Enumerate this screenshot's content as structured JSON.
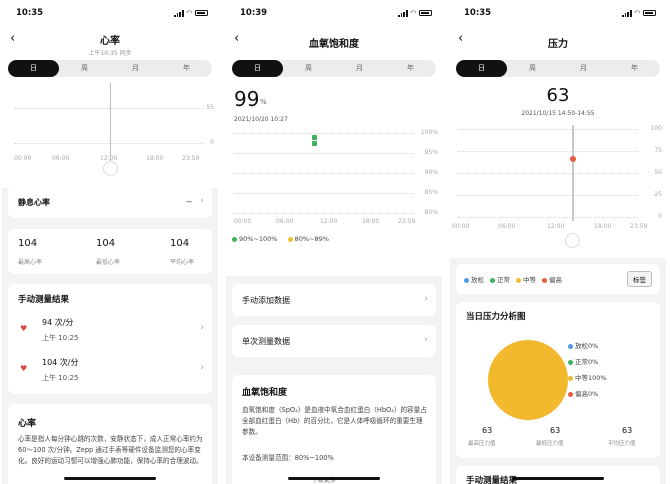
{
  "status_time_1": "10:35",
  "status_time_2": "10:39",
  "status_time_3": "10:35",
  "tabs": [
    "日",
    "周",
    "月",
    "年"
  ],
  "heart": {
    "title": "心率",
    "sync": "上午10:35 同步",
    "y_ticks": [
      "55",
      "0"
    ],
    "x_ticks": [
      "00:00",
      "06:00",
      "12:00",
      "18:00",
      "23:59"
    ],
    "resting_label": "静息心率",
    "resting_value": "--",
    "stats": [
      {
        "value": "104",
        "label": "最高心率"
      },
      {
        "value": "104",
        "label": "最低心率"
      },
      {
        "value": "104",
        "label": "平均心率"
      }
    ],
    "manual_title": "手动测量结果",
    "manual_items": [
      {
        "value": "94 次/分",
        "time": "上午 10:25"
      },
      {
        "value": "104 次/分",
        "time": "上午 10:25"
      }
    ],
    "info_title": "心率",
    "info_text": "心率是指人每分钟心跳的次数，安静状态下，成人正常心率约为 60～100 次/分钟。Zepp 通过手表等硬件设备监测您的心率变化。良好的运动习惯可以增强心肺功能，保持心率的合理波动。"
  },
  "spo2": {
    "title": "血氧饱和度",
    "value": "99",
    "unit": "%",
    "date": "2021/10/20 10:27",
    "y_ticks": [
      "100%",
      "95%",
      "90%",
      "85%",
      "80%"
    ],
    "x_ticks": [
      "00:00",
      "06:00",
      "12:00",
      "18:00",
      "23:59"
    ],
    "legend": [
      {
        "label": "90%~100%",
        "color": "#3cb25a"
      },
      {
        "label": "80%~89%",
        "color": "#f2c12e"
      }
    ],
    "rows": [
      "手动添加数据",
      "单次测量数据"
    ],
    "info_title": "血氧饱和度",
    "info_text": "血氧饱和度（SpO₂）是血液中氧合血红蛋白（HbO₂）的容量占全部血红蛋白（Hb）的百分比，它是人体呼吸循环的重要生理参数。",
    "range_text": "本设备测量范围：80%~100%",
    "more": "了解更多"
  },
  "stress": {
    "title": "压力",
    "value": "63",
    "date": "2021/10/15 14:50-14:55",
    "y_ticks": [
      "100",
      "75",
      "50",
      "25",
      "0"
    ],
    "x_ticks": [
      "00:00",
      "06:00",
      "12:00",
      "18:00",
      "23:59"
    ],
    "legend": [
      {
        "label": "放松",
        "color": "#4a9be8"
      },
      {
        "label": "正常",
        "color": "#3cb25a"
      },
      {
        "label": "中等",
        "color": "#f2b92e"
      },
      {
        "label": "偏高",
        "color": "#ea5a3c"
      }
    ],
    "tag_button": "标签",
    "analysis_title": "当日压力分析图",
    "pie": [
      {
        "label": "放松",
        "pct": "0%",
        "value": 0,
        "color": "#4a9be8"
      },
      {
        "label": "正常",
        "pct": "0%",
        "value": 0,
        "color": "#3cb25a"
      },
      {
        "label": "中等",
        "pct": "100%",
        "value": 100,
        "color": "#f2b92e"
      },
      {
        "label": "偏高",
        "pct": "0%",
        "value": 0,
        "color": "#ea5a3c"
      }
    ],
    "stats": [
      {
        "value": "63",
        "label": "最高压力值"
      },
      {
        "value": "63",
        "label": "最低压力值"
      },
      {
        "value": "63",
        "label": "平均压力值"
      }
    ],
    "manual_title": "手动测量结果"
  }
}
